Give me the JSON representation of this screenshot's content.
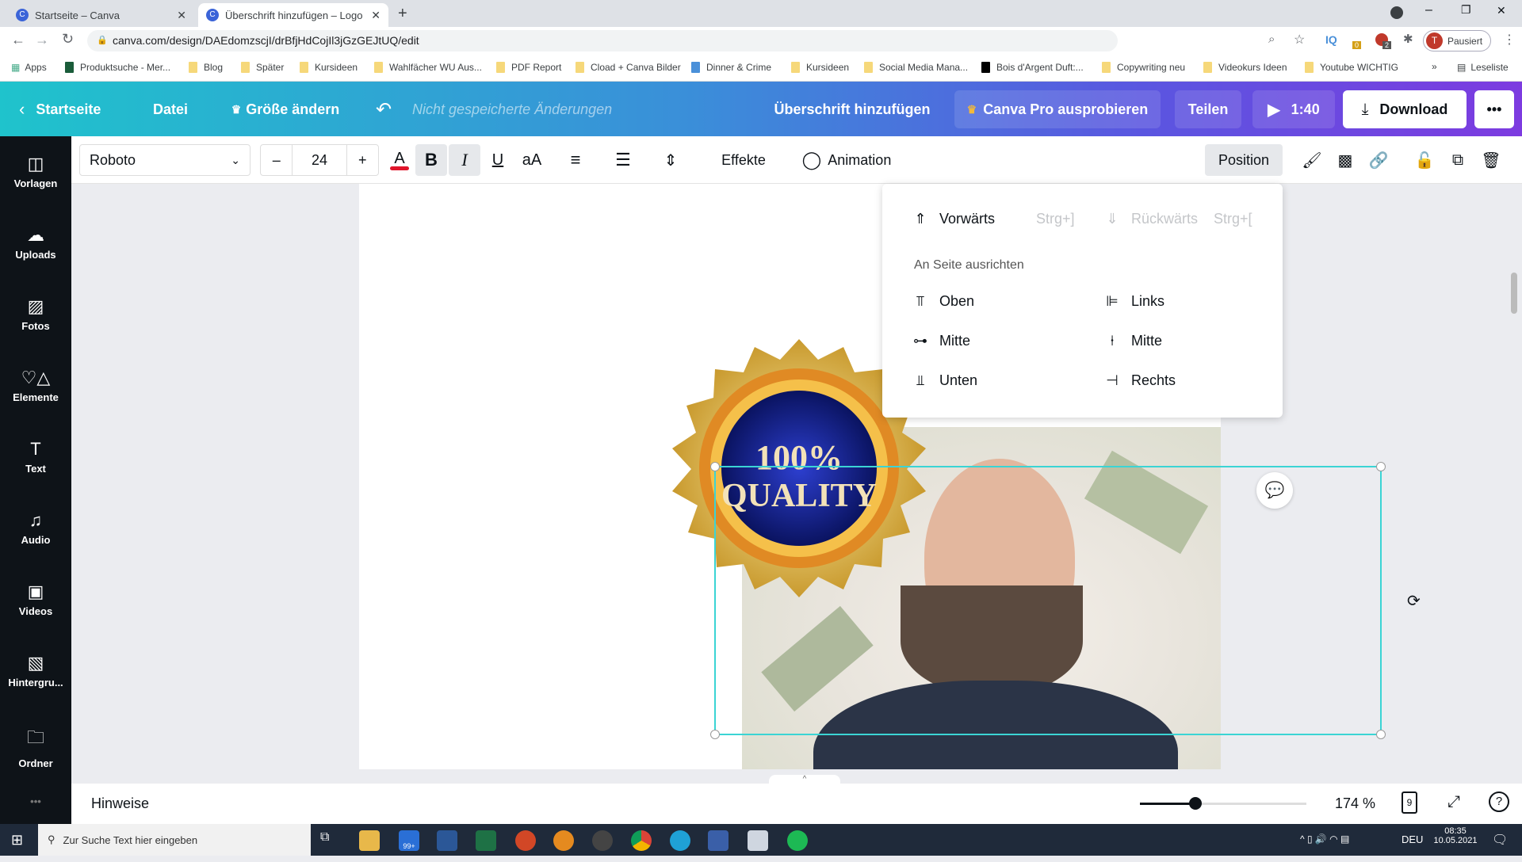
{
  "browser": {
    "tabs": [
      {
        "label": "Startseite – Canva",
        "active": false
      },
      {
        "label": "Überschrift hinzufügen – Logo",
        "active": true
      }
    ],
    "url": "canva.com/design/DAEdomzscjI/drBfjHdCojIl3jGzGEJtUQ/edit",
    "profile": {
      "initial": "T",
      "label": "Pausiert"
    },
    "extension_badges": [
      "0",
      "2"
    ],
    "bookmarks": [
      "Apps",
      "Produktsuche - Mer...",
      "Blog",
      "Später",
      "Kursideen",
      "Wahlfächer WU Aus...",
      "PDF Report",
      "Cload + Canva Bilder",
      "Dinner & Crime",
      "Kursideen",
      "Social Media Mana...",
      "Bois d'Argent Duft:...",
      "Copywriting neu",
      "Videokurs Ideen",
      "Youtube WICHTIG"
    ],
    "reading_list": "Leseliste"
  },
  "header": {
    "home": "Startseite",
    "file": "Datei",
    "resize": "Größe ändern",
    "status": "Nicht gespeicherte Änderungen",
    "title": "Überschrift hinzufügen",
    "pro": "Canva Pro ausprobieren",
    "share": "Teilen",
    "play": "1:40",
    "download": "Download",
    "more": "•••"
  },
  "toolbar": {
    "font": "Roboto",
    "size": "24",
    "minus": "–",
    "plus": "+",
    "text_color": "#e0162b",
    "bold": "B",
    "italic": "I",
    "underline": "U",
    "case": "aA",
    "effects": "Effekte",
    "animation": "Animation",
    "position": "Position"
  },
  "sidebar": [
    {
      "label": "Vorlagen",
      "icon": "layout-icon"
    },
    {
      "label": "Uploads",
      "icon": "cloud-upload-icon"
    },
    {
      "label": "Fotos",
      "icon": "image-icon"
    },
    {
      "label": "Elemente",
      "icon": "shapes-icon"
    },
    {
      "label": "Text",
      "icon": "text-icon"
    },
    {
      "label": "Audio",
      "icon": "music-icon"
    },
    {
      "label": "Videos",
      "icon": "video-icon"
    },
    {
      "label": "Hintergru...",
      "icon": "background-icon"
    },
    {
      "label": "Ordner",
      "icon": "folder-icon"
    }
  ],
  "position_menu": {
    "forward": {
      "label": "Vorwärts",
      "shortcut": "Strg+]"
    },
    "backward": {
      "label": "Rückwärts",
      "shortcut": "Strg+["
    },
    "section": "An Seite ausrichten",
    "align": {
      "top": "Oben",
      "middle_v": "Mitte",
      "bottom": "Unten",
      "left": "Links",
      "middle_h": "Mitte",
      "right": "Rechts"
    }
  },
  "canvas": {
    "badge_line1": "100%",
    "badge_line2": "QUALITY"
  },
  "bottom": {
    "notes": "Hinweise",
    "zoom": "174 %",
    "zoom_fraction": 0.33,
    "pages": "9"
  },
  "taskbar": {
    "search": "Zur Suche Text hier eingeben",
    "mail_badge": "99+",
    "lang": "DEU",
    "time": "08:35",
    "date": "10.05.2021"
  }
}
